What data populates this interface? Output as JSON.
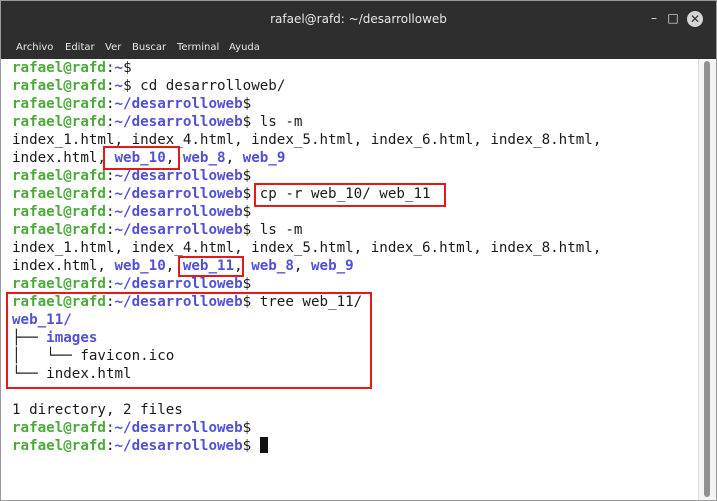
{
  "window": {
    "title": "rafael@rafd: ~/desarrolloweb"
  },
  "window_controls": {
    "minimize": "–",
    "maximize": "□",
    "close": "✕"
  },
  "menu": [
    "Archivo",
    "Editar",
    "Ver",
    "Buscar",
    "Terminal",
    "Ayuda"
  ],
  "terminal": {
    "user_host": "rafael@rafd",
    "colon": ":",
    "path_home": "~",
    "path_dir": "~/desarrolloweb",
    "prompt_symbol": "$",
    "cmd_cd": " cd desarrolloweb/",
    "cmd_ls": " ls -m",
    "cmd_cp": " cp -r web_10/ web_11",
    "cmd_tree": " tree web_11/",
    "ls1_line1": "index_1.html, index_4.html, index_5.html, index_6.html, index_8.html,",
    "ls1_l2_file": "index.html, ",
    "ls2_line1": "index_1.html, index_4.html, index_5.html, index_6.html, index_8.html,",
    "ls2_l2_file": "index.html, ",
    "sep": ", ",
    "dir_web10": "web_10",
    "dir_web11": "web_11",
    "dir_web8": "web_8",
    "dir_web9": "web_9",
    "tree_root": "web_11/",
    "tree_branch1": "├── ",
    "tree_images": "images",
    "tree_branch2": "│   └── ",
    "tree_favicon": "favicon.ico",
    "tree_branch3": "└── ",
    "tree_index": "index.html",
    "summary": "1 directory, 2 files"
  },
  "colors": {
    "prompt": "#4caa3a",
    "directory": "#5050d8",
    "highlight": "#e11a1a",
    "titlebar": "#2e2e2e"
  }
}
